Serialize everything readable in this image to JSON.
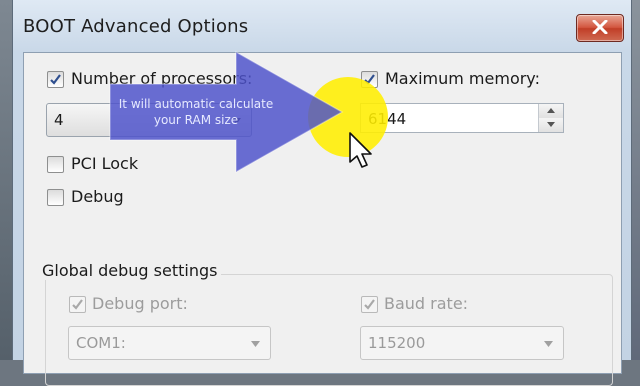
{
  "window": {
    "title": "BOOT Advanced Options"
  },
  "processors": {
    "label": "Number of processors:",
    "checked": true,
    "value": "4"
  },
  "max_memory": {
    "label": "Maximum memory:",
    "checked": true,
    "value": "6144"
  },
  "pci_lock": {
    "label": "PCI Lock",
    "checked": false
  },
  "debug": {
    "label": "Debug",
    "checked": false
  },
  "global_debug": {
    "title": "Global debug settings",
    "debug_port_label": "Debug port:",
    "debug_port_value": "COM1:",
    "baud_rate_label": "Baud rate:",
    "baud_rate_value": "115200"
  },
  "annotation": {
    "text_line1": "It will automatic calculate",
    "text_line2": "your RAM size"
  },
  "icons": [
    "close-icon",
    "checkmark-icon",
    "dropdown-arrow-icon",
    "spin-up-icon",
    "spin-down-icon",
    "pointer-cursor-icon",
    "callout-arrow"
  ],
  "colors": {
    "close_button": "#c9442c",
    "highlight": "#ffee00",
    "callout": "#4a52c8"
  }
}
